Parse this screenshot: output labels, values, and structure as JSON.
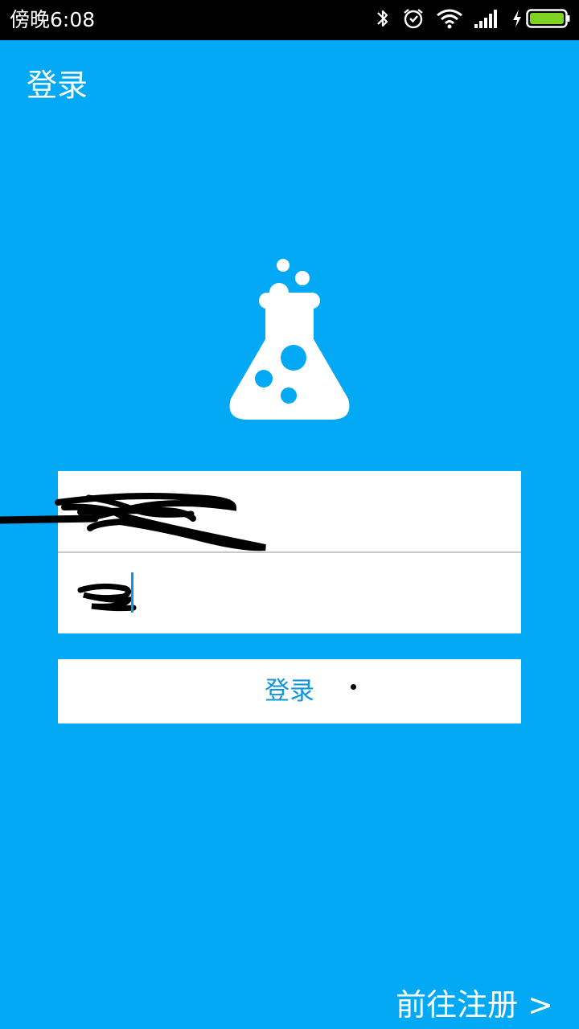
{
  "status_bar": {
    "time": "傍晚6:08",
    "icons": [
      "bluetooth-icon",
      "alarm-icon",
      "wifi-icon",
      "signal-icon",
      "charging-icon",
      "battery-icon"
    ],
    "battery_color": "#7ED321"
  },
  "app_bar": {
    "title": "登录"
  },
  "logo": {
    "icon": "flask-icon",
    "color": "#FFFFFF"
  },
  "form": {
    "username_value": "",
    "password_value": "",
    "login_label": "登录"
  },
  "footer": {
    "register_label": "前往注册 >"
  },
  "colors": {
    "background": "#03A9F4",
    "status_bar": "#000000",
    "button_text": "#1296DB"
  }
}
